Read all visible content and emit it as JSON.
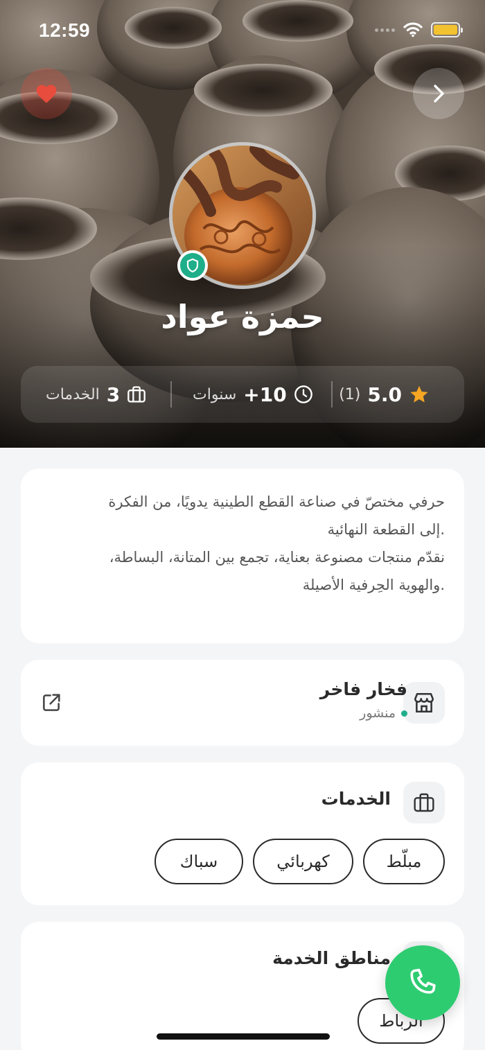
{
  "status_bar": {
    "time": "12:59"
  },
  "profile": {
    "name": "حمزة عواد",
    "verified": true
  },
  "stats": {
    "rating": "5.0",
    "rating_count": "(1)",
    "experience_value": "+10",
    "experience_unit": "سنوات",
    "services_count": "3",
    "services_label": "الخدمات"
  },
  "about": {
    "line1": "حرفي مختصّ في صناعة القطع الطينية يدويًا، من الفكرة",
    "line2": ".إلى القطعة النهائية",
    "line3": "نقدّم منتجات مصنوعة بعناية، تجمع بين المتانة، البساطة،",
    "line4": ".والهوية الحِرفية الأصيلة"
  },
  "shop": {
    "name": "فخار فاخر",
    "status": "منشور",
    "status_color": "#1fae8a"
  },
  "services": {
    "title": "الخدمات",
    "items": [
      "مبلّط",
      "كهربائي",
      "سباك"
    ]
  },
  "areas": {
    "title": "مناطق الخدمة",
    "items": [
      "الرباط"
    ]
  },
  "colors": {
    "accent_green": "#2ecc71",
    "verified_teal": "#1fae8a",
    "heart_red": "#e74c3c",
    "star_orange": "#f5a623"
  },
  "icons": {
    "favorite": "heart-icon",
    "next": "chevron-right-icon",
    "verified": "shield-icon",
    "rating": "star-icon",
    "experience": "clock-icon",
    "services": "briefcase-icon",
    "shop": "store-icon",
    "open_external": "external-link-icon",
    "call": "phone-icon"
  }
}
